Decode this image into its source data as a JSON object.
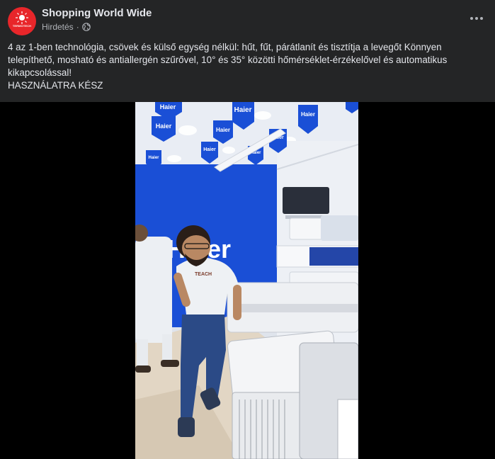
{
  "post": {
    "page_name": "Shopping World Wide",
    "sponsored_label": "Hirdetés",
    "separator": "·",
    "avatar_text": "TERMOTECH",
    "text_line1": "4 az 1-ben technológia, csövek és külső egység nélkül: hűt, fűt, párátlanít és tisztítja a levegőt Könnyen telepíthető, mosható és antiallergén szűrővel, 10° és 35° közötti hőmérséklet-érzékelővel és automatikus kikapcsolással!",
    "text_line2": "HASZNÁLATRA KÉSZ"
  },
  "video": {
    "brand_banners": [
      "Haier",
      "Haier",
      "Haier",
      "Haier",
      "Haier",
      "Haier",
      "Haier",
      "Haier",
      "Haier"
    ],
    "wall_logo": "Haier",
    "shirt_text": "TEACH"
  },
  "colors": {
    "background": "#242526",
    "brand_blue": "#1a4fd6",
    "avatar_red": "#e8262a"
  }
}
